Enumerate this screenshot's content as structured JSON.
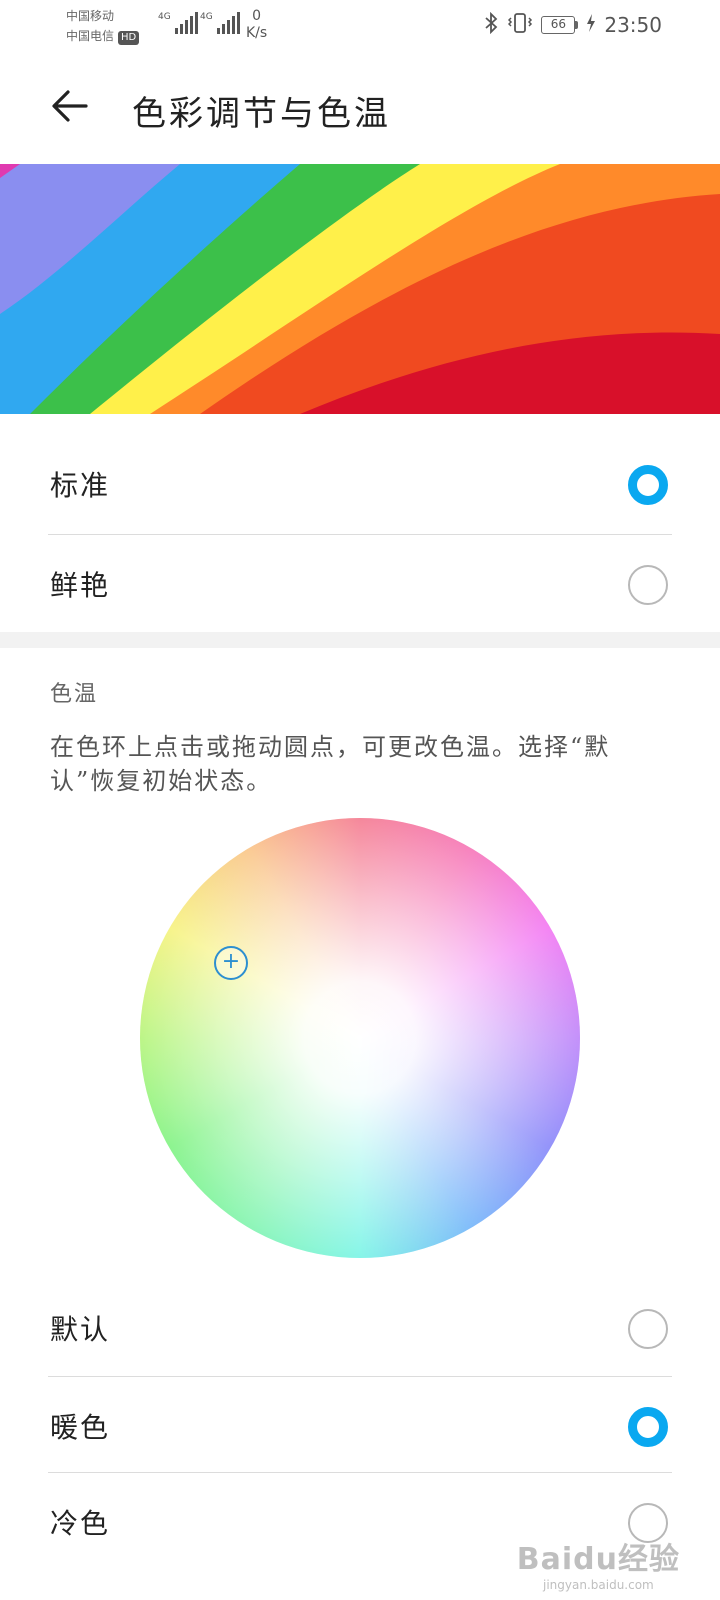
{
  "status_bar": {
    "carrier_1": "中国移动",
    "carrier_2": "中国电信",
    "hd": "HD",
    "signal_1_type": "4G",
    "signal_2_type": "4G",
    "speed_value": "0",
    "speed_unit": "K/s",
    "battery": "66",
    "time": "23:50",
    "icons": [
      "bluetooth-icon",
      "vibrate-icon",
      "charging-icon"
    ]
  },
  "app_bar": {
    "title": "色彩调节与色温",
    "back_icon": "arrow-left-icon"
  },
  "color_mode": {
    "options": [
      {
        "label": "标准",
        "selected": true
      },
      {
        "label": "鲜艳",
        "selected": false
      }
    ]
  },
  "color_temperature": {
    "title": "色温",
    "description": "在色环上点击或拖动圆点，可更改色温。选择“默认”恢复初始状态。",
    "picker_icon": "plus-icon",
    "options": [
      {
        "label": "默认",
        "selected": false
      },
      {
        "label": "暖色",
        "selected": true
      },
      {
        "label": "冷色",
        "selected": false
      }
    ]
  },
  "watermark": {
    "logo": "Baidu经验",
    "url": "jingyan.baidu.com"
  },
  "colors": {
    "accent": "#0aa8f0",
    "radio_off": "#b8b8b8",
    "divider": "#dcdcdc"
  }
}
